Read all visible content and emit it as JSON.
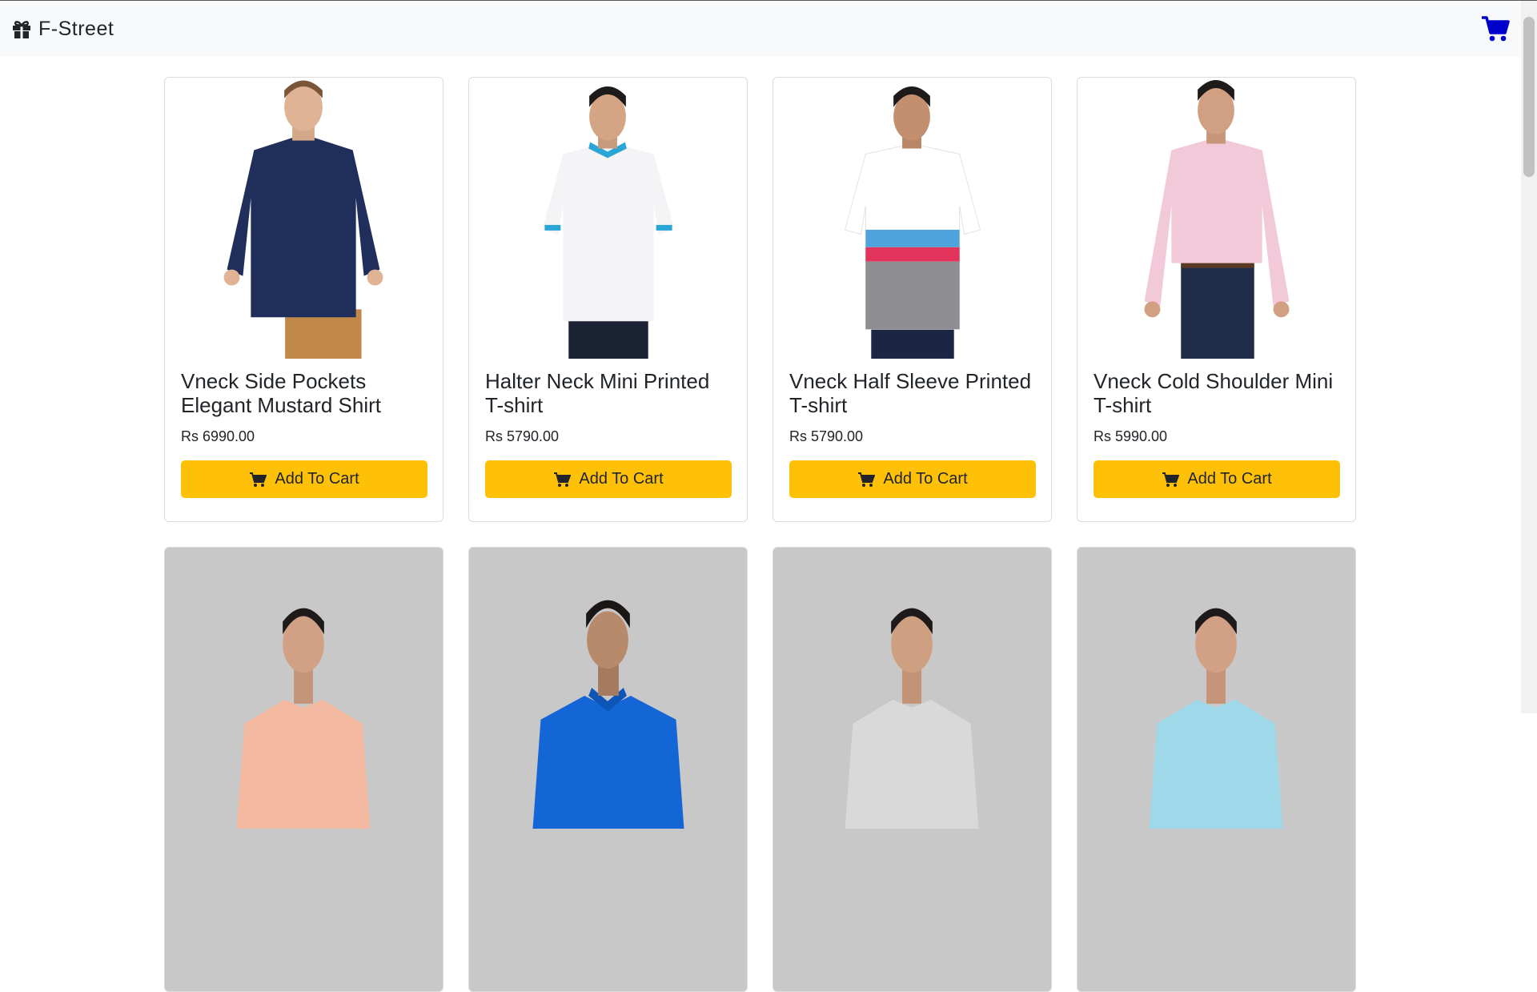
{
  "navbar": {
    "brand": "F-Street",
    "brand_icon": "gift-icon",
    "cart_icon": "cart-icon",
    "cart_color": "#0000cc"
  },
  "button_color": "#ffc107",
  "products": [
    {
      "title": "Vneck Side Pockets Elegant Mustard Shirt",
      "price": "Rs 6990.00",
      "button": "Add To Cart",
      "shirt_color": "#1f2e5a",
      "pants_color": "#c0894a"
    },
    {
      "title": "Halter Neck Mini Printed T-shirt",
      "price": "Rs 5790.00",
      "button": "Add To Cart",
      "shirt_color": "#f4f4f6",
      "pants_color": "#1b2233"
    },
    {
      "title": "Vneck Half Sleeve Printed T-shirt",
      "price": "Rs 5790.00",
      "button": "Add To Cart",
      "shirt_color": "#ffffff",
      "pants_color": "#1b2644"
    },
    {
      "title": "Vneck Cold Shoulder Mini T-shirt",
      "price": "Rs 5990.00",
      "button": "Add To Cart",
      "shirt_color": "#f2c9d8",
      "pants_color": "#1f2d4a"
    },
    {
      "shirt_color": "#f3b9a0"
    },
    {
      "shirt_color": "#1466d6"
    },
    {
      "shirt_color": "#d9d9d9"
    },
    {
      "shirt_color": "#9fd8e8"
    }
  ]
}
